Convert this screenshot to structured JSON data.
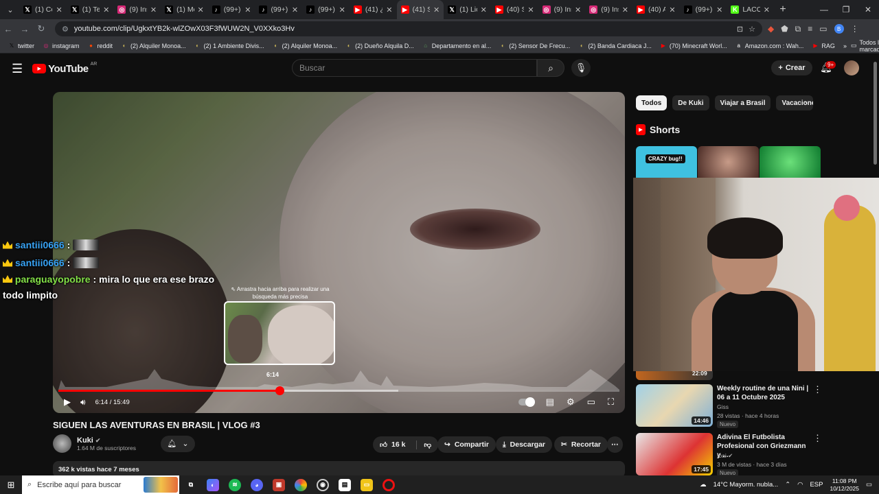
{
  "browser": {
    "tabs": [
      {
        "icon": "x-icon",
        "title": "(1) Co",
        "color": "#000000",
        "glyph": "𝕏"
      },
      {
        "icon": "x-icon",
        "title": "(1) Te",
        "color": "#000000",
        "glyph": "𝕏"
      },
      {
        "icon": "instagram-icon",
        "title": "(9) Ins",
        "color": "#d62976",
        "glyph": "◎"
      },
      {
        "icon": "x-icon",
        "title": "(1) Me",
        "color": "#000000",
        "glyph": "𝕏"
      },
      {
        "icon": "tiktok-icon",
        "title": "(99+) ",
        "color": "#000000",
        "glyph": "♪"
      },
      {
        "icon": "tiktok-icon",
        "title": "(99+) ",
        "color": "#000000",
        "glyph": "♪"
      },
      {
        "icon": "tiktok-icon",
        "title": "(99+) ",
        "color": "#000000",
        "glyph": "♪"
      },
      {
        "icon": "youtube-icon",
        "title": "(41) ¿",
        "color": "#ff0000",
        "glyph": "▶"
      },
      {
        "icon": "youtube-icon",
        "title": "(41) S",
        "color": "#ff0000",
        "glyph": "▶"
      },
      {
        "icon": "x-icon",
        "title": "(1) Lic",
        "color": "#000000",
        "glyph": "𝕏"
      },
      {
        "icon": "youtube-icon",
        "title": "(40) S",
        "color": "#ff0000",
        "glyph": "▶"
      },
      {
        "icon": "instagram-icon",
        "title": "(9) Ins",
        "color": "#d62976",
        "glyph": "◎"
      },
      {
        "icon": "instagram-icon",
        "title": "(9) Ins",
        "color": "#d62976",
        "glyph": "◎"
      },
      {
        "icon": "youtube-icon",
        "title": "(40) A",
        "color": "#ff0000",
        "glyph": "▶"
      },
      {
        "icon": "tiktok-icon",
        "title": "(99+) ",
        "color": "#000000",
        "glyph": "♪"
      },
      {
        "icon": "kick-icon",
        "title": "LACO",
        "color": "#53fc18",
        "glyph": "K"
      }
    ],
    "active_tab_index": 8,
    "url": "youtube.com/clip/UgkxtYB2k-wlZOwX03F3fWUW2N_V0XXko3Hv",
    "bookmarks": [
      {
        "label": "twitter",
        "icon": "x-icon",
        "glyph": "𝕏",
        "color": "#000000"
      },
      {
        "label": "instagram",
        "icon": "instagram-icon",
        "glyph": "◎",
        "color": "#d62976"
      },
      {
        "label": "reddit",
        "icon": "reddit-icon",
        "glyph": "●",
        "color": "#ff4500"
      },
      {
        "label": "(2) Alquiler Monoa...",
        "icon": "marketplace-icon",
        "glyph": "◐",
        "color": "#c9b458"
      },
      {
        "label": "(2) 1 Ambiente Divis...",
        "icon": "marketplace-icon",
        "glyph": "◐",
        "color": "#c9b458"
      },
      {
        "label": "(2) Alquiler Monoa...",
        "icon": "marketplace-icon",
        "glyph": "◐",
        "color": "#c9b458"
      },
      {
        "label": "(2) Dueño Alquila D...",
        "icon": "marketplace-icon",
        "glyph": "◐",
        "color": "#c9b458"
      },
      {
        "label": "Departamento en al...",
        "icon": "house-icon",
        "glyph": "⌂",
        "color": "#5a9a5a"
      },
      {
        "label": "(2) Sensor De Frecu...",
        "icon": "marketplace-icon",
        "glyph": "◐",
        "color": "#c9b458"
      },
      {
        "label": "(2) Banda Cardiaca J...",
        "icon": "marketplace-icon",
        "glyph": "◐",
        "color": "#c9b458"
      },
      {
        "label": "(70) Minecraft Worl...",
        "icon": "youtube-icon",
        "glyph": "▶",
        "color": "#ff0000"
      },
      {
        "label": "Amazon.com : Wah...",
        "icon": "amazon-icon",
        "glyph": "a",
        "color": "#ffffff"
      },
      {
        "label": "RAG",
        "icon": "youtube-icon",
        "glyph": "▶",
        "color": "#ff0000"
      }
    ],
    "all_bookmarks": "Todos los marcadores"
  },
  "youtube": {
    "logo": "YouTube",
    "country": "AR",
    "search_placeholder": "Buscar",
    "create": "Crear",
    "notif_badge": "9+"
  },
  "player": {
    "hint": "⇖ Arrastra hacia arriba para realizar una búsqueda más precisa",
    "preview_time": "6:14",
    "time": "6:14 / 15:49",
    "progress_fraction": 0.394
  },
  "chat": [
    {
      "user": "santiii0666",
      "message": ""
    },
    {
      "user": "santiii0666",
      "message": ""
    },
    {
      "user": "paraguayopobre",
      "message": "mira lo que era ese brazo todo limpito"
    }
  ],
  "video": {
    "title": "SIGUEN LAS AVENTURAS EN BRASIL | VLOG #3",
    "channel": "Kuki",
    "subscribers": "1.64 M de suscriptores",
    "likes": "16 k",
    "share": "Compartir",
    "download": "Descargar",
    "clip": "Recortar",
    "desc": "362 k vistas  hace 7 meses"
  },
  "sidebar": {
    "chips": [
      "Todos",
      "De Kuki",
      "Viajar a Brasil",
      "Vacaciones"
    ],
    "shorts_title": "Shorts",
    "crazy_bug": "CRAZY bug!!",
    "hidden_duration": "22:09",
    "recommended": [
      {
        "title": "Weekly routine de una Nini | 06 a 11 Octubre 2025",
        "channel": "Giss",
        "meta": "28 vistas · hace 4 horas",
        "badge": "Nuevo",
        "duration": "14:46"
      },
      {
        "title": "Adivina El Futbolista Profesional con Griezmann y ...",
        "channel": "Ibai ✔",
        "meta": "3 M de vistas · hace 3 días",
        "badge": "Nuevo",
        "duration": "17:45"
      }
    ]
  },
  "taskbar": {
    "search_placeholder": "Escribe aquí para buscar",
    "weather": "14°C  Mayorm. nubla...",
    "lang": "ESP",
    "time": "11:08 PM",
    "date": "10/12/2025"
  }
}
